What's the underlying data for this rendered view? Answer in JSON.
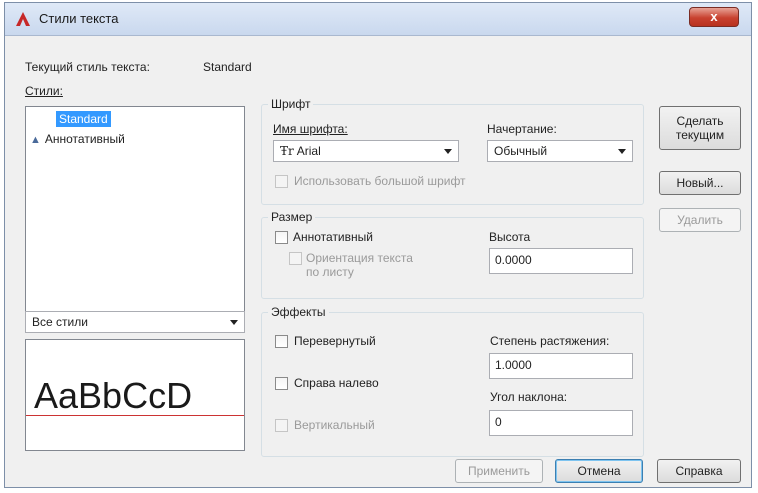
{
  "window": {
    "title": "Стили текста",
    "close_label": "x"
  },
  "current_style": {
    "label": "Текущий стиль текста:",
    "value": "Standard"
  },
  "styles": {
    "label": "Стили:",
    "items": [
      {
        "label": "Standard",
        "selected": true
      },
      {
        "label": "Аннотативный",
        "icon": "annotative-triangle-icon"
      }
    ],
    "filter_value": "Все стили"
  },
  "preview": {
    "sample_text": "AaBbCcD"
  },
  "font_group": {
    "title": "Шрифт",
    "font_name_label": "Имя шрифта:",
    "font_name_value": "Arial",
    "font_icon": "truetype-font-icon",
    "style_label": "Начертание:",
    "style_value": "Обычный",
    "big_font_label": "Использовать большой шрифт"
  },
  "size_group": {
    "title": "Размер",
    "annotative_label": "Аннотативный",
    "orientation_label_line1": "Ориентация текста",
    "orientation_label_line2": "по листу",
    "height_label": "Высота",
    "height_value": "0.0000"
  },
  "effects_group": {
    "title": "Эффекты",
    "upside_down_label": "Перевернутый",
    "backwards_label": "Справа налево",
    "vertical_label": "Вертикальный",
    "width_factor_label": "Степень растяжения:",
    "width_factor_value": "1.0000",
    "oblique_angle_label": "Угол наклона:",
    "oblique_angle_value": "0"
  },
  "side_buttons": {
    "set_current_line1": "Сделать",
    "set_current_line2": "текущим",
    "new_label": "Новый...",
    "delete_label": "Удалить"
  },
  "bottom_buttons": {
    "apply_label": "Применить",
    "cancel_label": "Отмена",
    "help_label": "Справка"
  },
  "colors": {
    "selection": "#3399ff",
    "close_button": "#c8412f",
    "baseline": "#cc3333"
  }
}
